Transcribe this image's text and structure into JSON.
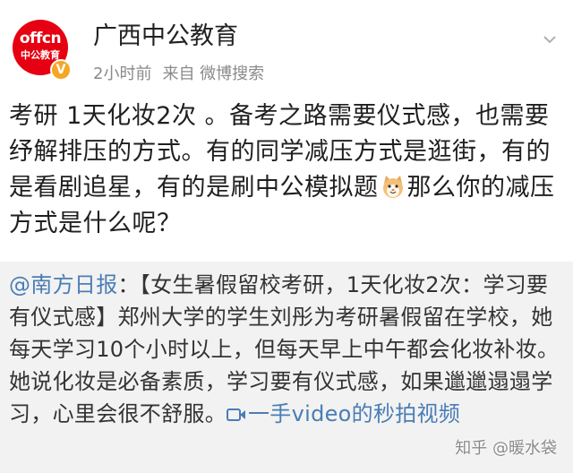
{
  "header": {
    "avatar_brand": "offcn",
    "avatar_brand_cn": "中公教育",
    "verified_mark": "V",
    "username": "广西中公教育",
    "time": "2小时前",
    "source": "来自 微博搜索",
    "menu_icon": "chevron-down-icon"
  },
  "post": {
    "text_before_emoji": "考研 1天化妆2次 。备考之路需要仪式感，也需要纾解排压的方式。有的同学减压方式是逛街，有的是看剧追星，有的是刷中公模拟题",
    "emoji": "cat-face-icon",
    "text_after_emoji": "那么你的减压方式是什么呢？"
  },
  "repost": {
    "mention": "@南方日报",
    "body": "：【女生暑假留校考研，1天化妆2次：学习要有仪式感】郑州大学的学生刘彤为考研暑假留在学校，她每天学习10个小时以上，但每天早上中午都会化妆补妆。她说化妆是必备素质，学习要有仪式感，如果邋邋遢遢学习，心里会很不舒服。",
    "video_link": "一手video的秒拍视频"
  },
  "watermark": "知乎 @暖水袋",
  "colors": {
    "link": "#4a7db5",
    "brand_red": "#e60012",
    "badge": "#f5a623",
    "repost_bg": "#f2f2f2"
  }
}
